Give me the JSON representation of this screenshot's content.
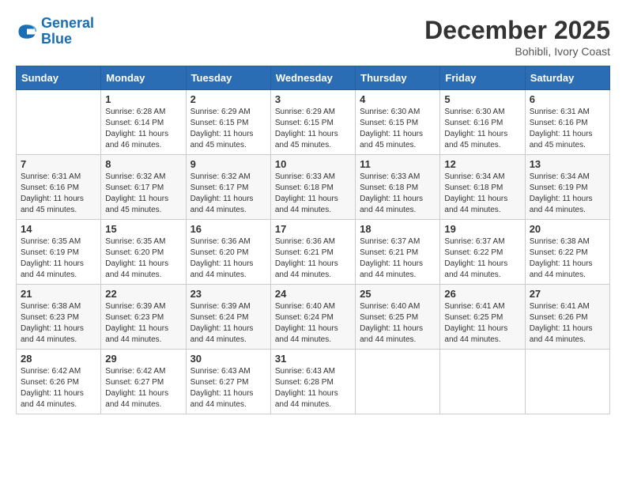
{
  "logo": {
    "line1": "General",
    "line2": "Blue"
  },
  "title": "December 2025",
  "subtitle": "Bohibli, Ivory Coast",
  "days_of_week": [
    "Sunday",
    "Monday",
    "Tuesday",
    "Wednesday",
    "Thursday",
    "Friday",
    "Saturday"
  ],
  "weeks": [
    [
      {
        "day": "",
        "sunrise": "",
        "sunset": "",
        "daylight": ""
      },
      {
        "day": "1",
        "sunrise": "Sunrise: 6:28 AM",
        "sunset": "Sunset: 6:14 PM",
        "daylight": "Daylight: 11 hours and 46 minutes."
      },
      {
        "day": "2",
        "sunrise": "Sunrise: 6:29 AM",
        "sunset": "Sunset: 6:15 PM",
        "daylight": "Daylight: 11 hours and 45 minutes."
      },
      {
        "day": "3",
        "sunrise": "Sunrise: 6:29 AM",
        "sunset": "Sunset: 6:15 PM",
        "daylight": "Daylight: 11 hours and 45 minutes."
      },
      {
        "day": "4",
        "sunrise": "Sunrise: 6:30 AM",
        "sunset": "Sunset: 6:15 PM",
        "daylight": "Daylight: 11 hours and 45 minutes."
      },
      {
        "day": "5",
        "sunrise": "Sunrise: 6:30 AM",
        "sunset": "Sunset: 6:16 PM",
        "daylight": "Daylight: 11 hours and 45 minutes."
      },
      {
        "day": "6",
        "sunrise": "Sunrise: 6:31 AM",
        "sunset": "Sunset: 6:16 PM",
        "daylight": "Daylight: 11 hours and 45 minutes."
      }
    ],
    [
      {
        "day": "7",
        "sunrise": "Sunrise: 6:31 AM",
        "sunset": "Sunset: 6:16 PM",
        "daylight": "Daylight: 11 hours and 45 minutes."
      },
      {
        "day": "8",
        "sunrise": "Sunrise: 6:32 AM",
        "sunset": "Sunset: 6:17 PM",
        "daylight": "Daylight: 11 hours and 45 minutes."
      },
      {
        "day": "9",
        "sunrise": "Sunrise: 6:32 AM",
        "sunset": "Sunset: 6:17 PM",
        "daylight": "Daylight: 11 hours and 44 minutes."
      },
      {
        "day": "10",
        "sunrise": "Sunrise: 6:33 AM",
        "sunset": "Sunset: 6:18 PM",
        "daylight": "Daylight: 11 hours and 44 minutes."
      },
      {
        "day": "11",
        "sunrise": "Sunrise: 6:33 AM",
        "sunset": "Sunset: 6:18 PM",
        "daylight": "Daylight: 11 hours and 44 minutes."
      },
      {
        "day": "12",
        "sunrise": "Sunrise: 6:34 AM",
        "sunset": "Sunset: 6:18 PM",
        "daylight": "Daylight: 11 hours and 44 minutes."
      },
      {
        "day": "13",
        "sunrise": "Sunrise: 6:34 AM",
        "sunset": "Sunset: 6:19 PM",
        "daylight": "Daylight: 11 hours and 44 minutes."
      }
    ],
    [
      {
        "day": "14",
        "sunrise": "Sunrise: 6:35 AM",
        "sunset": "Sunset: 6:19 PM",
        "daylight": "Daylight: 11 hours and 44 minutes."
      },
      {
        "day": "15",
        "sunrise": "Sunrise: 6:35 AM",
        "sunset": "Sunset: 6:20 PM",
        "daylight": "Daylight: 11 hours and 44 minutes."
      },
      {
        "day": "16",
        "sunrise": "Sunrise: 6:36 AM",
        "sunset": "Sunset: 6:20 PM",
        "daylight": "Daylight: 11 hours and 44 minutes."
      },
      {
        "day": "17",
        "sunrise": "Sunrise: 6:36 AM",
        "sunset": "Sunset: 6:21 PM",
        "daylight": "Daylight: 11 hours and 44 minutes."
      },
      {
        "day": "18",
        "sunrise": "Sunrise: 6:37 AM",
        "sunset": "Sunset: 6:21 PM",
        "daylight": "Daylight: 11 hours and 44 minutes."
      },
      {
        "day": "19",
        "sunrise": "Sunrise: 6:37 AM",
        "sunset": "Sunset: 6:22 PM",
        "daylight": "Daylight: 11 hours and 44 minutes."
      },
      {
        "day": "20",
        "sunrise": "Sunrise: 6:38 AM",
        "sunset": "Sunset: 6:22 PM",
        "daylight": "Daylight: 11 hours and 44 minutes."
      }
    ],
    [
      {
        "day": "21",
        "sunrise": "Sunrise: 6:38 AM",
        "sunset": "Sunset: 6:23 PM",
        "daylight": "Daylight: 11 hours and 44 minutes."
      },
      {
        "day": "22",
        "sunrise": "Sunrise: 6:39 AM",
        "sunset": "Sunset: 6:23 PM",
        "daylight": "Daylight: 11 hours and 44 minutes."
      },
      {
        "day": "23",
        "sunrise": "Sunrise: 6:39 AM",
        "sunset": "Sunset: 6:24 PM",
        "daylight": "Daylight: 11 hours and 44 minutes."
      },
      {
        "day": "24",
        "sunrise": "Sunrise: 6:40 AM",
        "sunset": "Sunset: 6:24 PM",
        "daylight": "Daylight: 11 hours and 44 minutes."
      },
      {
        "day": "25",
        "sunrise": "Sunrise: 6:40 AM",
        "sunset": "Sunset: 6:25 PM",
        "daylight": "Daylight: 11 hours and 44 minutes."
      },
      {
        "day": "26",
        "sunrise": "Sunrise: 6:41 AM",
        "sunset": "Sunset: 6:25 PM",
        "daylight": "Daylight: 11 hours and 44 minutes."
      },
      {
        "day": "27",
        "sunrise": "Sunrise: 6:41 AM",
        "sunset": "Sunset: 6:26 PM",
        "daylight": "Daylight: 11 hours and 44 minutes."
      }
    ],
    [
      {
        "day": "28",
        "sunrise": "Sunrise: 6:42 AM",
        "sunset": "Sunset: 6:26 PM",
        "daylight": "Daylight: 11 hours and 44 minutes."
      },
      {
        "day": "29",
        "sunrise": "Sunrise: 6:42 AM",
        "sunset": "Sunset: 6:27 PM",
        "daylight": "Daylight: 11 hours and 44 minutes."
      },
      {
        "day": "30",
        "sunrise": "Sunrise: 6:43 AM",
        "sunset": "Sunset: 6:27 PM",
        "daylight": "Daylight: 11 hours and 44 minutes."
      },
      {
        "day": "31",
        "sunrise": "Sunrise: 6:43 AM",
        "sunset": "Sunset: 6:28 PM",
        "daylight": "Daylight: 11 hours and 44 minutes."
      },
      {
        "day": "",
        "sunrise": "",
        "sunset": "",
        "daylight": ""
      },
      {
        "day": "",
        "sunrise": "",
        "sunset": "",
        "daylight": ""
      },
      {
        "day": "",
        "sunrise": "",
        "sunset": "",
        "daylight": ""
      }
    ]
  ]
}
